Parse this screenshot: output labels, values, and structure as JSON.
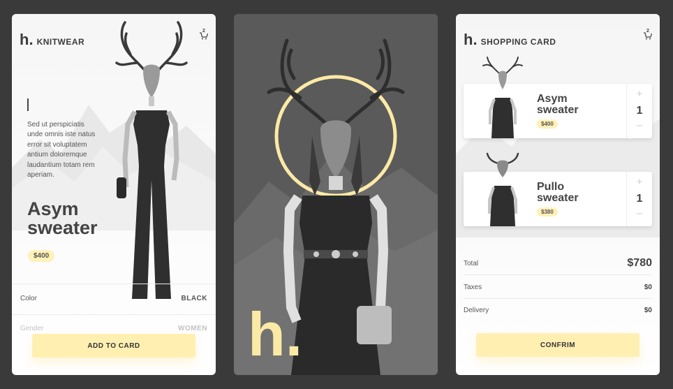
{
  "colors": {
    "accent": "#fff0b2",
    "halo": "#fbe9a6",
    "text": "#444444"
  },
  "product_screen": {
    "brand_mark": "h.",
    "brand_name": "KNITWEAR",
    "cart_icon": "cart-icon",
    "cart_count": "2",
    "description": "Sed ut perspiciatis unde omnis iste natus error sit voluptatem antium doloremque laudantium totam rem aperiam.",
    "title_line1": "Asym",
    "title_line2": "sweater",
    "price": "$400",
    "attributes": [
      {
        "label": "Color",
        "value": "BLACK"
      },
      {
        "label": "Gender",
        "value": "WOMEN"
      }
    ],
    "add_button": "ADD TO CARD"
  },
  "hero_screen": {
    "logo": "h."
  },
  "cart_screen": {
    "brand_mark": "h.",
    "title": "SHOPPING CARD",
    "cart_icon": "cart-icon",
    "cart_count": "2",
    "items": [
      {
        "name_line1": "Asym",
        "name_line2": "sweater",
        "price": "$400",
        "qty": "1",
        "plus": "+",
        "minus": "−"
      },
      {
        "name_line1": "Pullo",
        "name_line2": "sweater",
        "price": "$380",
        "qty": "1",
        "plus": "+",
        "minus": "−"
      }
    ],
    "summary": [
      {
        "label": "Total",
        "value": "$780"
      },
      {
        "label": "Taxes",
        "value": "$0"
      },
      {
        "label": "Delivery",
        "value": "$0"
      }
    ],
    "confirm_button": "CONFRIM"
  }
}
